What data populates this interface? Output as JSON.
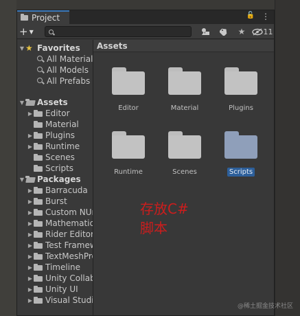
{
  "window": {
    "tab_label": "Project",
    "lock_glyph": "🔓",
    "menu_glyph": "⋮"
  },
  "toolbar": {
    "create_glyph": "+",
    "create_caret": "▼",
    "search_value": "",
    "search_placeholder": "",
    "hidden_count": "11"
  },
  "tree": {
    "favorites": {
      "label": "Favorites",
      "items": [
        "All Materials",
        "All Models",
        "All Prefabs"
      ]
    },
    "assets": {
      "label": "Assets",
      "items": [
        "Editor",
        "Material",
        "Plugins",
        "Runtime",
        "Scenes",
        "Scripts"
      ]
    },
    "packages": {
      "label": "Packages",
      "items": [
        "Barracuda",
        "Burst",
        "Custom NUnit",
        "Mathematics",
        "Rider Editor",
        "Test Framework",
        "TextMeshPro",
        "Timeline",
        "Unity Collaborate",
        "Unity UI",
        "Visual Studio"
      ]
    }
  },
  "main": {
    "breadcrumb": "Assets",
    "folders": [
      "Editor",
      "Material",
      "Plugins",
      "Runtime",
      "Scenes",
      "Scripts"
    ],
    "selected_folder": "Scripts"
  },
  "annotation": {
    "line1": "存放C#",
    "line2": "脚本"
  },
  "watermark": "@稀土掘金技术社区",
  "colors": {
    "selection": "#2d5f9a",
    "selected_folder": "#8f9fba",
    "annotation": "#cc1d1d",
    "favorites_star": "#e6c242",
    "tab_accent": "#3a79bb"
  }
}
